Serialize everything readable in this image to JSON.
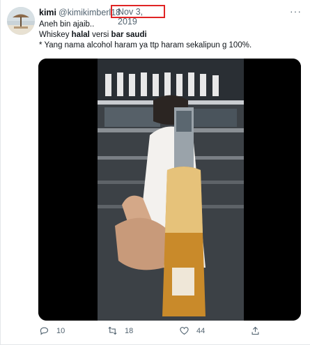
{
  "tweet": {
    "author_name": "kimi",
    "author_handle": "@kimikimberl18",
    "date": "Nov 3, 2019",
    "menu_glyph": "···",
    "line1": "Aneh bin ajaib..",
    "line2_parts": [
      "Whiskey ",
      "halal",
      " versi ",
      "bar saudi"
    ],
    "line3": "* Yang nama alcohol haram ya ttp haram sekalipun g 100%.",
    "highlight_color": "#e02424"
  },
  "actions": {
    "reply_count": "10",
    "retweet_count": "18",
    "like_count": "44",
    "reply_icon": "reply-icon",
    "retweet_icon": "retweet-icon",
    "like_icon": "heart-icon",
    "share_icon": "share-icon"
  }
}
